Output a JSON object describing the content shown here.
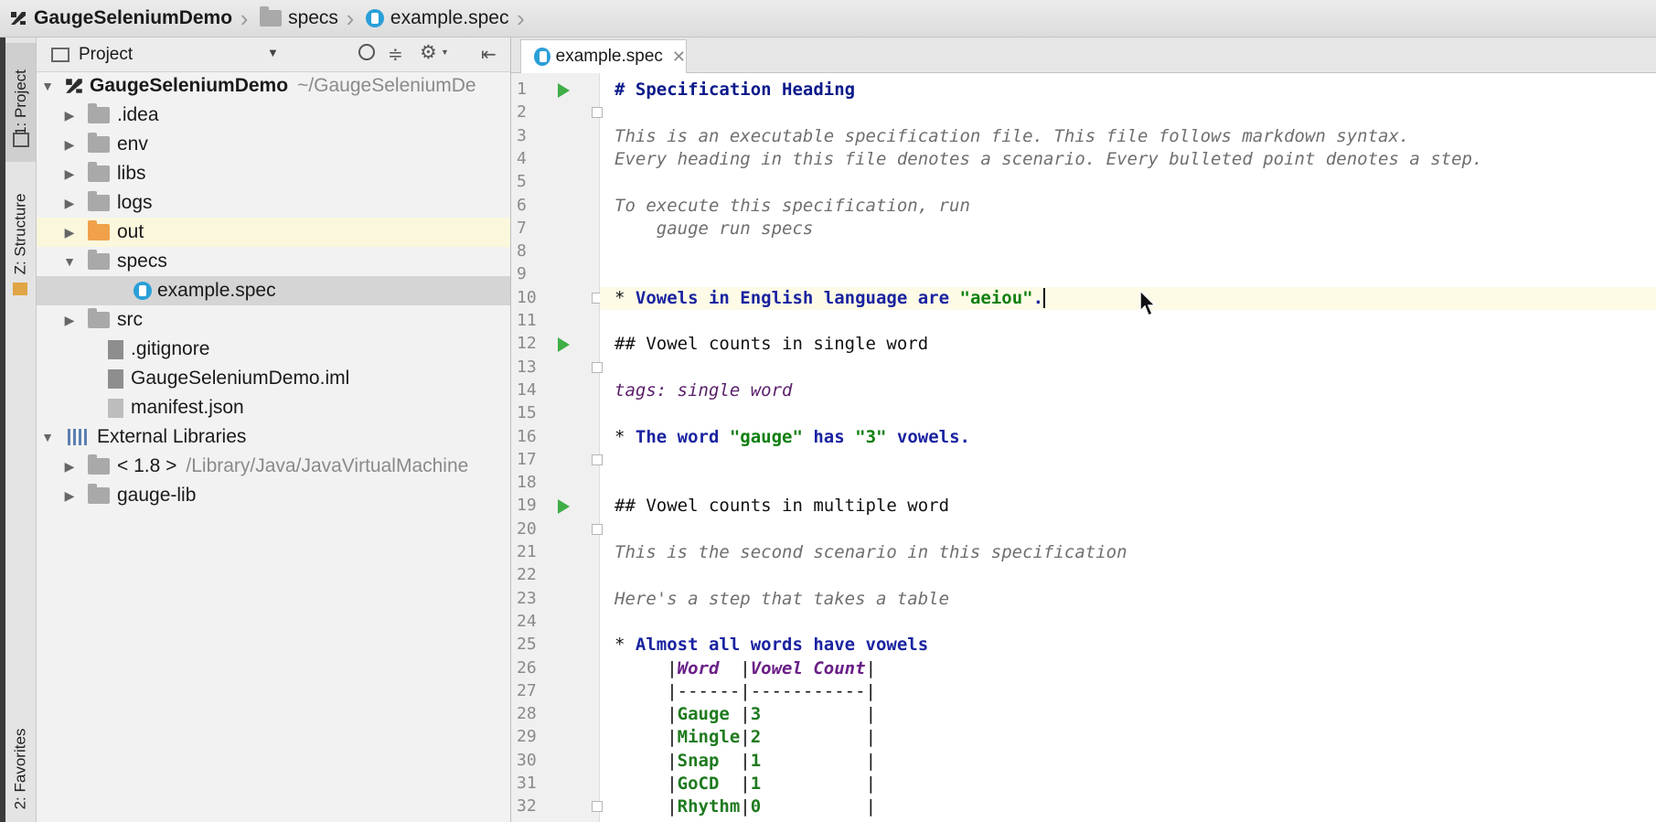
{
  "breadcrumbs": [
    "GaugeSeleniumDemo",
    "specs",
    "example.spec"
  ],
  "left_strip": {
    "project_tab": "1: Project",
    "structure_tab": "Z: Structure",
    "favorites_tab": "2: Favorites"
  },
  "project_panel": {
    "title": "Project",
    "tree": [
      {
        "label": "GaugeSeleniumDemo",
        "extra": "~/GaugeSeleniumDe",
        "expanded": true,
        "kind": "module"
      },
      {
        "label": ".idea",
        "kind": "folder"
      },
      {
        "label": "env",
        "kind": "folder"
      },
      {
        "label": "libs",
        "kind": "folder"
      },
      {
        "label": "logs",
        "kind": "folder"
      },
      {
        "label": "out",
        "kind": "folder-orange"
      },
      {
        "label": "specs",
        "kind": "folder",
        "expanded": true
      },
      {
        "label": "example.spec",
        "kind": "spec"
      },
      {
        "label": "src",
        "kind": "folder"
      },
      {
        "label": ".gitignore",
        "kind": "file"
      },
      {
        "label": "GaugeSeleniumDemo.iml",
        "kind": "file"
      },
      {
        "label": "manifest.json",
        "kind": "file"
      },
      {
        "label": "External Libraries",
        "kind": "libs",
        "expanded": true
      },
      {
        "label": "< 1.8 >",
        "extra": "/Library/Java/JavaVirtualMachine",
        "kind": "jdk"
      },
      {
        "label": "gauge-lib",
        "kind": "lib"
      }
    ]
  },
  "editor": {
    "tab_label": "example.spec",
    "lines": [
      {
        "n": "1",
        "run": true,
        "parts": [
          [
            "# Specification Heading",
            "c-h1"
          ]
        ]
      },
      {
        "n": "2",
        "fold": true,
        "parts": []
      },
      {
        "n": "3",
        "parts": [
          [
            "This is an executable specification file. This file follows markdown syntax.",
            "c-com"
          ]
        ]
      },
      {
        "n": "4",
        "parts": [
          [
            "Every heading in this file denotes a scenario. Every bulleted point denotes a step.",
            "c-com"
          ]
        ]
      },
      {
        "n": "5",
        "parts": []
      },
      {
        "n": "6",
        "parts": [
          [
            "To execute this specification, run",
            "c-com"
          ]
        ]
      },
      {
        "n": "7",
        "parts": [
          [
            "    gauge run specs",
            "c-com"
          ]
        ]
      },
      {
        "n": "8",
        "parts": []
      },
      {
        "n": "9",
        "parts": []
      },
      {
        "n": "10",
        "fold": true,
        "current": true,
        "parts": [
          [
            "* ",
            "c-pipe"
          ],
          [
            "Vowels in English language are ",
            "c-step"
          ],
          [
            "\"aeiou\"",
            "c-str"
          ],
          [
            ".",
            "c-step"
          ]
        ]
      },
      {
        "n": "11",
        "parts": []
      },
      {
        "n": "12",
        "run": true,
        "parts": [
          [
            "## Vowel counts in single word",
            "c-h2"
          ]
        ]
      },
      {
        "n": "13",
        "fold": true,
        "parts": []
      },
      {
        "n": "14",
        "parts": [
          [
            "tags: single word",
            "c-tag"
          ]
        ]
      },
      {
        "n": "15",
        "parts": []
      },
      {
        "n": "16",
        "parts": [
          [
            "* ",
            "c-pipe"
          ],
          [
            "The word ",
            "c-step"
          ],
          [
            "\"gauge\"",
            "c-str"
          ],
          [
            " has ",
            "c-step"
          ],
          [
            "\"3\"",
            "c-str"
          ],
          [
            " vowels.",
            "c-step"
          ]
        ]
      },
      {
        "n": "17",
        "fold": true,
        "parts": []
      },
      {
        "n": "18",
        "parts": []
      },
      {
        "n": "19",
        "run": true,
        "parts": [
          [
            "## Vowel counts in multiple word",
            "c-h2"
          ]
        ]
      },
      {
        "n": "20",
        "fold": true,
        "parts": []
      },
      {
        "n": "21",
        "parts": [
          [
            "This is the second scenario in this specification",
            "c-com"
          ]
        ]
      },
      {
        "n": "22",
        "parts": []
      },
      {
        "n": "23",
        "parts": [
          [
            "Here's a step that takes a table",
            "c-com"
          ]
        ]
      },
      {
        "n": "24",
        "parts": []
      },
      {
        "n": "25",
        "parts": [
          [
            "* ",
            "c-pipe"
          ],
          [
            "Almost all words have vowels",
            "c-step"
          ]
        ]
      },
      {
        "n": "26",
        "parts": [
          [
            "     |",
            "c-pipe"
          ],
          [
            "Word  ",
            "c-th"
          ],
          [
            "|",
            "c-pipe"
          ],
          [
            "Vowel Count",
            "c-th"
          ],
          [
            "|",
            "c-pipe"
          ]
        ]
      },
      {
        "n": "27",
        "parts": [
          [
            "     |------|-----------|",
            "c-pipe"
          ]
        ]
      },
      {
        "n": "28",
        "parts": [
          [
            "     |",
            "c-pipe"
          ],
          [
            "Gauge ",
            "c-td"
          ],
          [
            "|",
            "c-pipe"
          ],
          [
            "3          ",
            "c-td"
          ],
          [
            "|",
            "c-pipe"
          ]
        ]
      },
      {
        "n": "29",
        "parts": [
          [
            "     |",
            "c-pipe"
          ],
          [
            "Mingle",
            "c-td"
          ],
          [
            "|",
            "c-pipe"
          ],
          [
            "2          ",
            "c-td"
          ],
          [
            "|",
            "c-pipe"
          ]
        ]
      },
      {
        "n": "30",
        "parts": [
          [
            "     |",
            "c-pipe"
          ],
          [
            "Snap  ",
            "c-td"
          ],
          [
            "|",
            "c-pipe"
          ],
          [
            "1          ",
            "c-td"
          ],
          [
            "|",
            "c-pipe"
          ]
        ]
      },
      {
        "n": "31",
        "parts": [
          [
            "     |",
            "c-pipe"
          ],
          [
            "GoCD  ",
            "c-td"
          ],
          [
            "|",
            "c-pipe"
          ],
          [
            "1          ",
            "c-td"
          ],
          [
            "|",
            "c-pipe"
          ]
        ]
      },
      {
        "n": "32",
        "fold": true,
        "parts": [
          [
            "     |",
            "c-pipe"
          ],
          [
            "Rhythm",
            "c-td"
          ],
          [
            "|",
            "c-pipe"
          ],
          [
            "0          ",
            "c-td"
          ],
          [
            "|",
            "c-pipe"
          ]
        ]
      }
    ]
  }
}
